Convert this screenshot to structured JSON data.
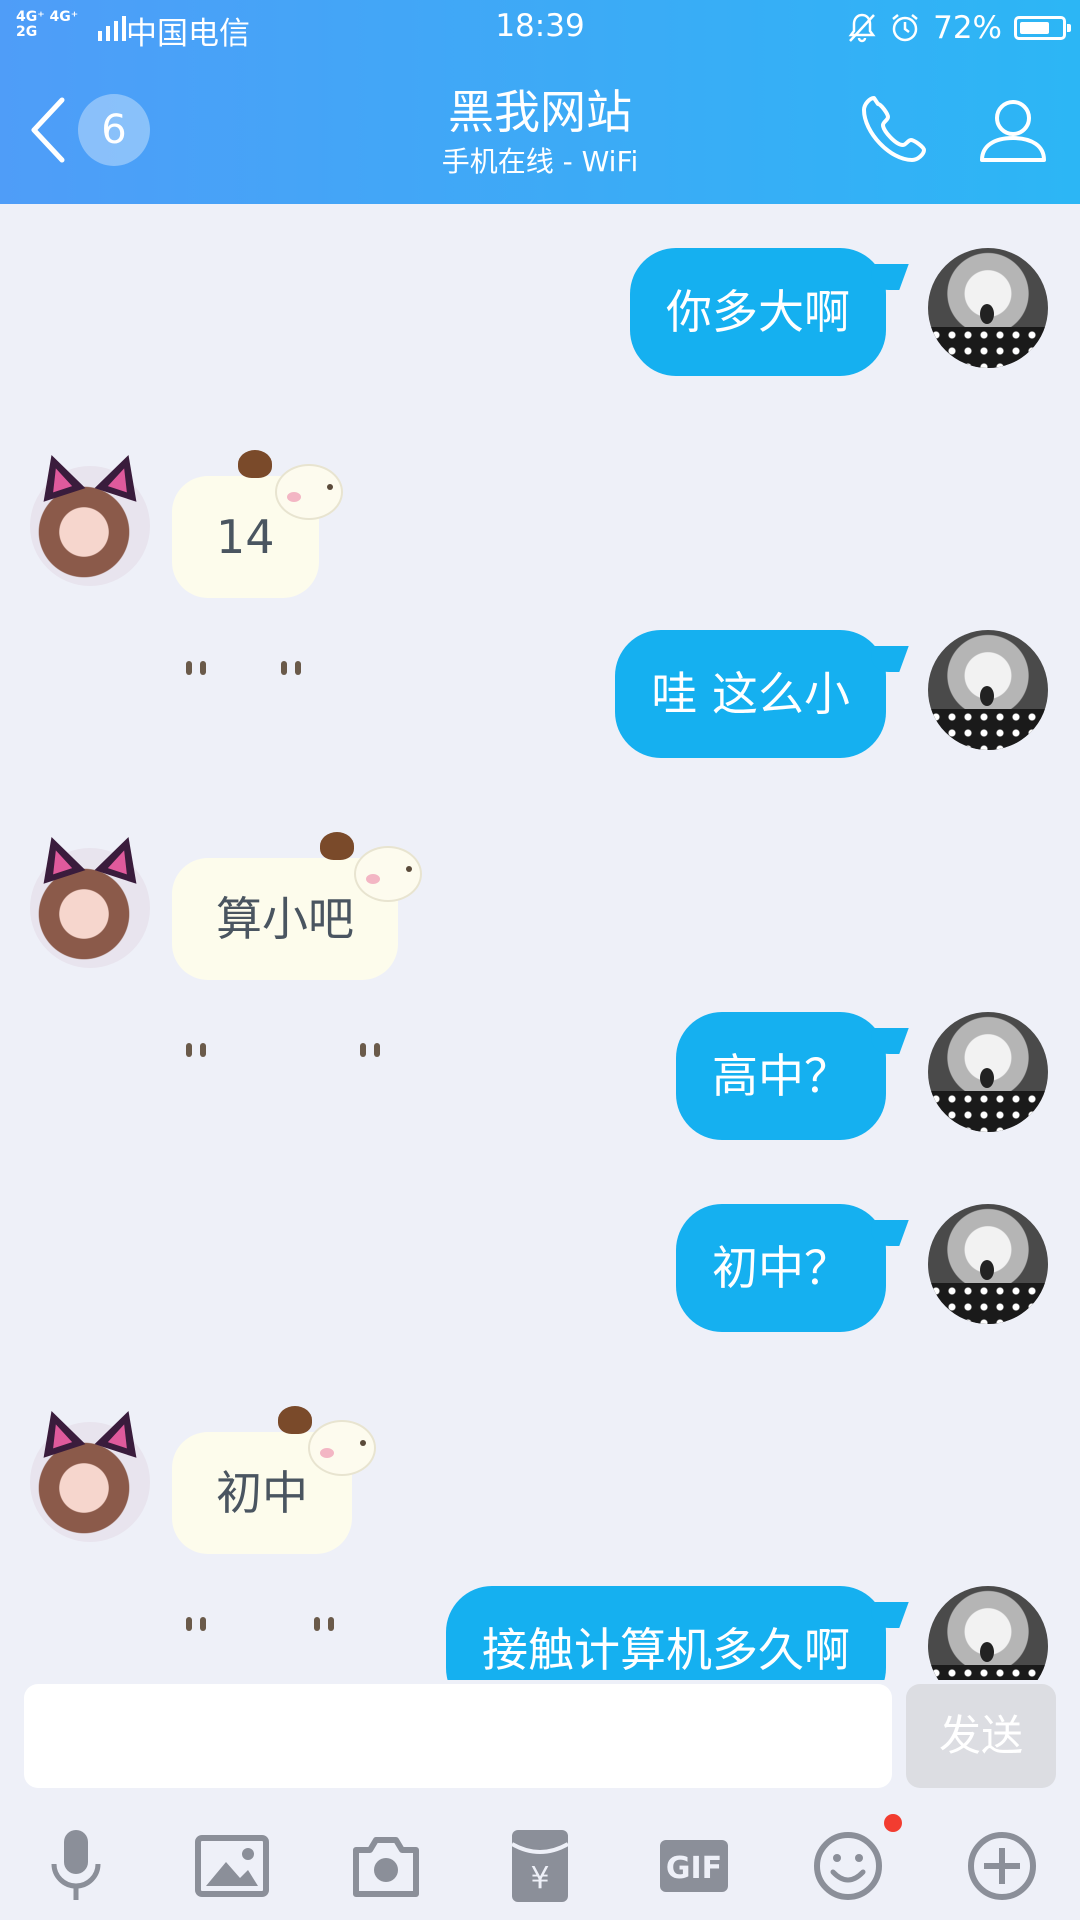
{
  "status_bar": {
    "network": "4G⁺ 4G⁺\n2G",
    "carrier": "中国电信",
    "time": "18:39",
    "battery": "72%",
    "battery_level": 0.72
  },
  "header": {
    "unread_count": "6",
    "title": "黑我网站",
    "subtitle": "手机在线 - WiFi"
  },
  "messages": [
    {
      "side": "out",
      "text": "你多大啊"
    },
    {
      "side": "in",
      "text": "14"
    },
    {
      "side": "out",
      "text": "哇 这么小"
    },
    {
      "side": "in",
      "text": "算小吧"
    },
    {
      "side": "out",
      "text": "高中？"
    },
    {
      "side": "out",
      "text": "初中？"
    },
    {
      "side": "in",
      "text": "初中"
    },
    {
      "side": "out",
      "text": "接触计算机多久啊"
    }
  ],
  "composer": {
    "input_value": "",
    "send_label": "发送"
  },
  "toolbar": {
    "items": [
      "microphone-icon",
      "image-icon",
      "camera-icon",
      "red-packet-icon",
      "gif-icon",
      "emoji-icon",
      "plus-icon"
    ],
    "gif_label": "GIF",
    "emoji_has_notification": true
  },
  "colors": {
    "header_gradient_start": "#4f9df8",
    "header_gradient_end": "#2cb6f5",
    "outgoing_bubble": "#15b0f0",
    "incoming_bubble": "#fdfcec",
    "notification_dot": "#f23c30"
  }
}
